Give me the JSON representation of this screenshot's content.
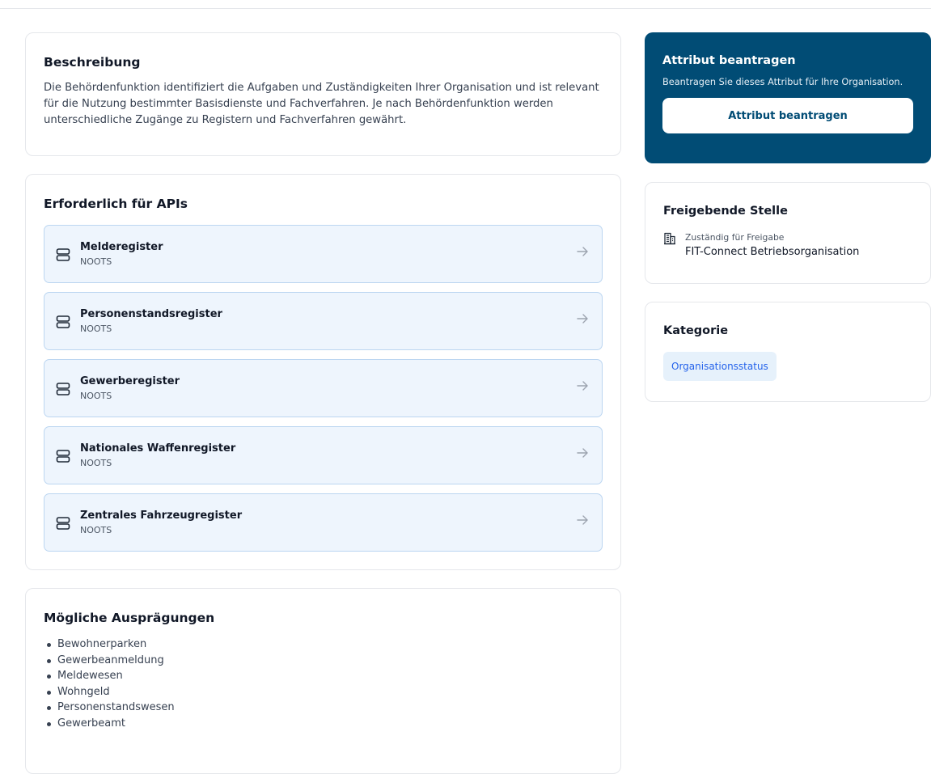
{
  "description": {
    "title": "Beschreibung",
    "text": "Die Behördenfunktion identifiziert die Aufgaben und Zuständigkeiten Ihrer Organisation und ist relevant für die Nutzung bestimmter Basisdienste und Fachverfahren. Je nach Behördenfunktion werden unterschiedliche Zugänge zu Registern und Fachverfahren gewährt."
  },
  "apis": {
    "title": "Erforderlich für APIs",
    "items": [
      {
        "name": "Melderegister",
        "sub": "NOOTS",
        "icon": "server-icon"
      },
      {
        "name": "Personenstandsregister",
        "sub": "NOOTS",
        "icon": "server-icon"
      },
      {
        "name": "Gewerberegister",
        "sub": "NOOTS",
        "icon": "server-icon"
      },
      {
        "name": "Nationales Waffenregister",
        "sub": "NOOTS",
        "icon": "server-icon"
      },
      {
        "name": "Zentrales Fahrzeugregister",
        "sub": "NOOTS",
        "icon": "server-icon"
      }
    ]
  },
  "forms": {
    "title": "Mögliche Ausprägungen",
    "items": [
      "Bewohnerparken",
      "Gewerbeanmeldung",
      "Meldewesen",
      "Wohngeld",
      "Personenstandswesen",
      "Gewerbeamt"
    ]
  },
  "request": {
    "title": "Attribut beantragen",
    "text": "Beantragen Sie dieses Attribut für Ihre Organisation.",
    "button_label": "Attribut beantragen",
    "bg_color": "#014c75"
  },
  "authority": {
    "title": "Freigebende Stelle",
    "label": "Zuständig für Freigabe",
    "value": "FIT-Connect Betriebsorganisation",
    "icon": "building-icon"
  },
  "category": {
    "title": "Kategorie",
    "badge": "Organisationsstatus"
  }
}
